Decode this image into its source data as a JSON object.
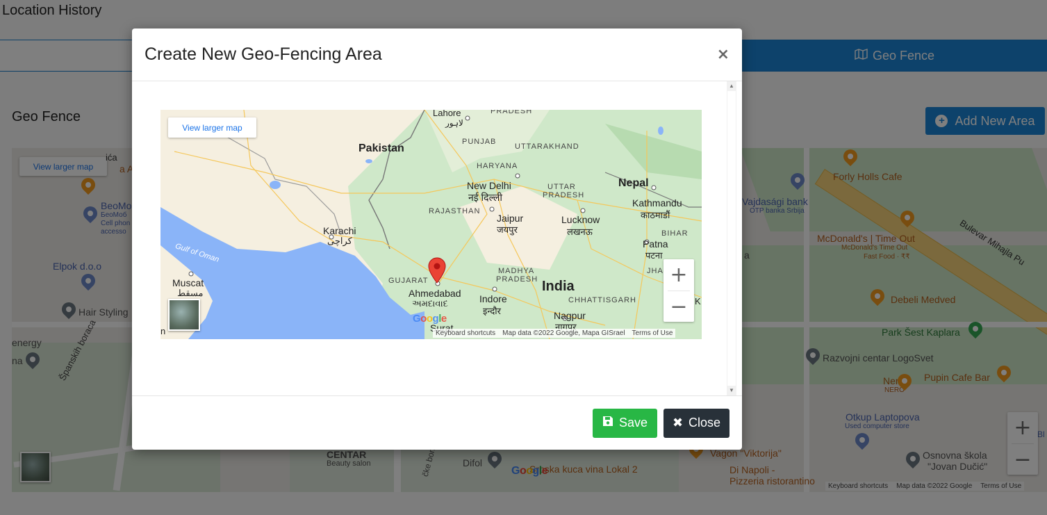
{
  "page": {
    "title": "Location History",
    "tabs": {
      "left_icon": "map-marker-icon",
      "geo_fence": "Geo Fence",
      "geo_fence_icon": "map-icon"
    },
    "section_title": "Geo Fence",
    "add_button": "Add New Area"
  },
  "background_map": {
    "view_larger": "View larger map",
    "places": {
      "forly": "Forly Holls Cafe",
      "vojvodjanska": "Vajdasági bank",
      "otp": "OTP banka Srbija",
      "mcd": "McDonald's | Time Out",
      "mcd_sub1": "McDonald's Time Out",
      "mcd_sub2": "Fast Food · ₹₹",
      "bulevar": "Bulevar Mihajla Pu",
      "debeli": "Debeli Medved",
      "park": "Park Šest Kaplara",
      "razvojni": "Razvojni centar LogoSvet",
      "nero": "Nero",
      "nero_sub": "NERO",
      "pupin": "Pupin Cafe Bar",
      "otkup": "Otkup Laptopova",
      "otkup_sub": "Used computer store",
      "skola": "Osnovna škola",
      "skola2": "\"Jovan Dučić\"",
      "vagon": "Vagon \"Viktorija\"",
      "dinapoli": "Di Napoli -",
      "dinapoli2": "Pizzeria ristorantino",
      "srpska": "Srpska kuca vina Lokal 2",
      "difol": "Difol",
      "centar": "CENTAR",
      "centar_sub": "Beauty salon",
      "elpok": "Elpok d.o.o",
      "beomob": "BeoMo",
      "beomob_sub1": "БеоМоб",
      "beomob_sub2": "Cell phon",
      "beomob_sub3": "accesso",
      "hair": "Hair Styling",
      "energy": "energy",
      "na": "na",
      "spanskih": "Španskih boraca",
      "cka": "ića",
      "aw": "a Aw",
      "ske": "čke borbe",
      "bl": "Bl",
      "a_side": "a"
    },
    "attribution": {
      "shortcuts": "Keyboard shortcuts",
      "data": "Map data ©2022 Google",
      "terms": "Terms of Use"
    },
    "google": "Google"
  },
  "modal": {
    "title": "Create New Geo-Fencing Area",
    "close_x": "×",
    "map": {
      "view_larger": "View larger map",
      "labels": {
        "lahore": "Lahore",
        "lahore_ur": "لاہور",
        "pradesh_top": "PRADESH",
        "pakistan": "Pakistan",
        "punjab": "PUNJAB",
        "uttarakhand": "UTTARAKHAND",
        "haryana": "HARYANA",
        "newdelhi": "New Delhi",
        "newdelhi_hi": "नई दिल्ली",
        "uttar": "UTTAR",
        "pradesh_up": "PRADESH",
        "nepal": "Nepal",
        "kathmandu": "Kathmandu",
        "kathmandu_ne": "काठमाडौं",
        "rajasthan": "RAJASTHAN",
        "jaipur": "Jaipur",
        "jaipur_hi": "जयपुर",
        "lucknow": "Lucknow",
        "lucknow_hi": "लखनऊ",
        "bihar": "BIHAR",
        "karachi": "Karachi",
        "karachi_ur": "کراچی",
        "gulf": "Gulf of Oman",
        "patna": "Patna",
        "patna_hi": "पटना",
        "madhya": "MADHYA",
        "pradesh_mp": "PRADESH",
        "jharkh": "JHARKH",
        "muscat": "Muscat",
        "muscat_ar": "مسقط",
        "gujarat": "GUJARAT",
        "india": "India",
        "ahmedabad": "Ahmedabad",
        "ahmedabad_gu": "અમદાવાદ",
        "indore": "Indore",
        "indore_hi": "इन्दौर",
        "chhattisgarh": "CHHATTISGARH",
        "nagpur": "Nagpur",
        "nagpur_hi": "नागपुर",
        "surat": "Surat",
        "k": "K",
        "n": "n"
      },
      "attribution": {
        "shortcuts": "Keyboard shortcuts",
        "data": "Map data ©2022 Google, Mapa GISrael",
        "terms": "Terms of Use"
      },
      "google": "Google"
    },
    "save": "Save",
    "close": "Close"
  },
  "colors": {
    "primary": "#1b84d6",
    "save": "#28b745",
    "close": "#283139",
    "water": "#8ab4f8",
    "land": "#f5efe0",
    "green": "#cfe8c9",
    "pin": "#ea4335"
  }
}
